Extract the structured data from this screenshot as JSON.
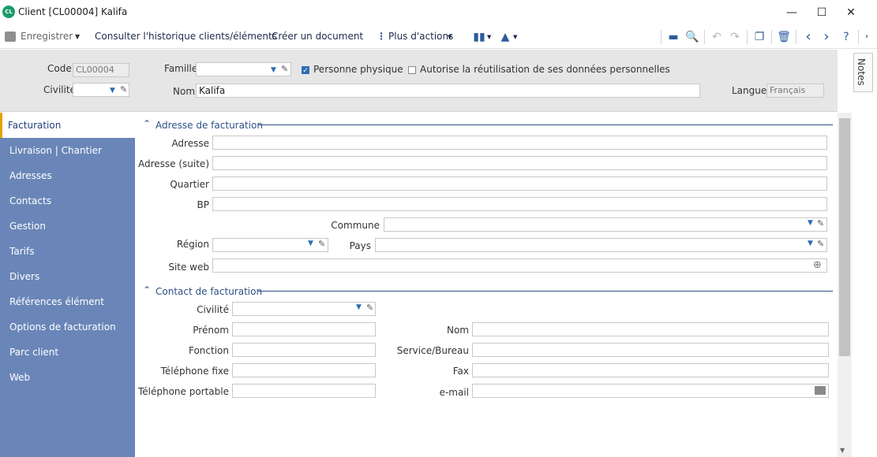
{
  "window": {
    "logo_text": "CL",
    "title": "Client [CL00004] Kalifa",
    "minimize": "—",
    "maximize": "☐",
    "close": "✕"
  },
  "toolbar": {
    "save_label": "Enregistrer",
    "history_label": "Consulter l'historique clients/éléments",
    "create_doc_label": "Créer un document",
    "more_actions_label": "Plus d'actions"
  },
  "header": {
    "code_label": "Code",
    "code_value": "CL00004",
    "famille_label": "Famille",
    "famille_value": "",
    "personne_physique_label": "Personne physique",
    "personne_physique_checked": true,
    "autorise_label": "Autorise la réutilisation de ses données personnelles",
    "autorise_checked": false,
    "civilite_label": "Civilité",
    "civilite_value": "",
    "nom_label": "Nom",
    "nom_value": "Kalifa",
    "langue_label": "Langue",
    "langue_value": "Français"
  },
  "sidebar": {
    "items": [
      {
        "label": "Facturation",
        "active": true
      },
      {
        "label": "Livraison | Chantier"
      },
      {
        "label": "Adresses"
      },
      {
        "label": "Contacts"
      },
      {
        "label": "Gestion"
      },
      {
        "label": "Tarifs"
      },
      {
        "label": "Divers"
      },
      {
        "label": "Références élément"
      },
      {
        "label": "Options de facturation"
      },
      {
        "label": "Parc client"
      },
      {
        "label": "Web"
      }
    ]
  },
  "billing_address": {
    "section_title": "Adresse de facturation",
    "adresse_label": "Adresse",
    "adresse_suite_label": "Adresse (suite)",
    "quartier_label": "Quartier",
    "bp_label": "BP",
    "commune_label": "Commune",
    "region_label": "Région",
    "pays_label": "Pays",
    "site_web_label": "Site web"
  },
  "billing_contact": {
    "section_title": "Contact de facturation",
    "civilite_label": "Civilité",
    "prenom_label": "Prénom",
    "nom_label": "Nom",
    "fonction_label": "Fonction",
    "service_label": "Service/Bureau",
    "tel_fixe_label": "Téléphone fixe",
    "fax_label": "Fax",
    "tel_portable_label": "Téléphone portable",
    "email_label": "e-mail"
  },
  "notes_label": "Notes"
}
